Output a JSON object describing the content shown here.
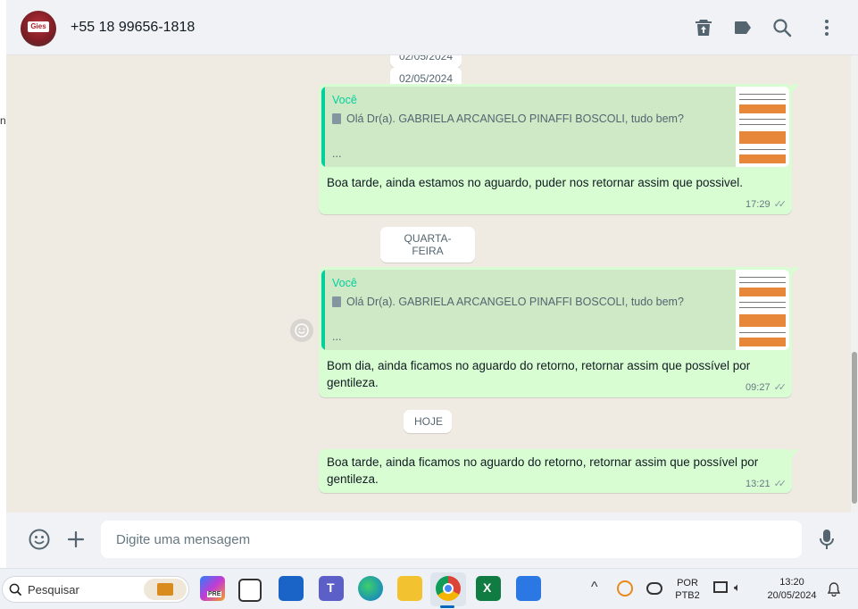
{
  "header": {
    "contact_name": "+55 18 99656-1818",
    "avatar_text": "Gies",
    "icons": [
      "delete-icon",
      "label-icon",
      "search-icon",
      "more-options-icon"
    ]
  },
  "chat": {
    "date_top_partial": "02/05/2024",
    "date_1": "02/05/2024",
    "date_2": "QUARTA-FEIRA",
    "date_3": "HOJE",
    "messages": [
      {
        "quote_author": "Você",
        "quote_preview": "Olá Dr(a). GABRIELA ARCANGELO PINAFFI BOSCOLI, tudo bem?",
        "quote_ellipsis": "...",
        "text": "Boa tarde, ainda estamos no aguardo, puder nos retornar assim que possivel.",
        "time": "17:29"
      },
      {
        "quote_author": "Você",
        "quote_preview": "Olá Dr(a). GABRIELA ARCANGELO PINAFFI BOSCOLI, tudo bem?",
        "quote_ellipsis": "...",
        "text_line1": "Bom dia, ainda ficamos no aguardo do retorno, retornar assim que possível por",
        "text_line2": "gentileza.",
        "time": "09:27"
      },
      {
        "text_line1": "Boa tarde, ainda ficamos no aguardo do retorno, retornar assim que possível por",
        "text_line2": "gentileza.",
        "time": "13:21"
      }
    ]
  },
  "footer": {
    "placeholder": "Digite uma mensagem"
  },
  "taskbar": {
    "search_label": "Pesquisar",
    "copilot_badge": "PRE",
    "language_line1": "POR",
    "language_line2": "PTB2",
    "time": "13:20",
    "date": "20/05/2024"
  },
  "colors": {
    "bubble_out": "#d9fdd3",
    "accent": "#06cf9c",
    "chat_bg": "#efeae2"
  }
}
